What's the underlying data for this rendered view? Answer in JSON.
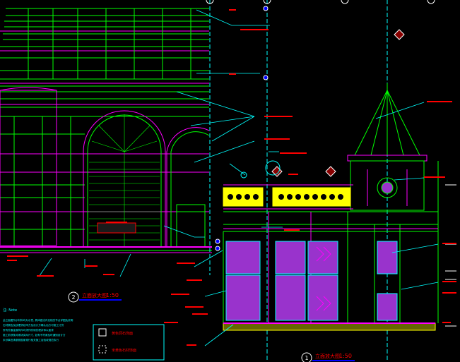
{
  "drawing": {
    "left_elevation_title": "立面放大图",
    "left_elevation_scale": "1:50",
    "left_elevation_number": "2",
    "right_elevation_title": "立面放大图",
    "right_elevation_scale": "1:50",
    "right_elevation_number": "1"
  },
  "notes": {
    "heading": "注: Note",
    "lines": [
      "此立面图所示材料均为示意, 具体做法详见相关节点详图及说明",
      "石材颜色及纹理须经甲方及设计方确认后方可施工订货",
      "所有外露金属构件均须作防锈处理并饰以面漆",
      "施工前须核对现场实际尺寸, 如有不符请及时通知设计方",
      "未尽事宜请参照国家现行相关施工及验收规范执行"
    ]
  },
  "legend": {
    "items": [
      {
        "label": "黄色洞石饰面"
      },
      {
        "label": "米黄色石材饰面"
      }
    ]
  },
  "colors": {
    "background": "#000000",
    "green": "#00ff00",
    "magenta": "#ff00ff",
    "cyan": "#00ffff",
    "red": "#ff0000",
    "yellow": "#ffff00",
    "purple_fill": "#9933cc",
    "blue": "#0000ff"
  }
}
